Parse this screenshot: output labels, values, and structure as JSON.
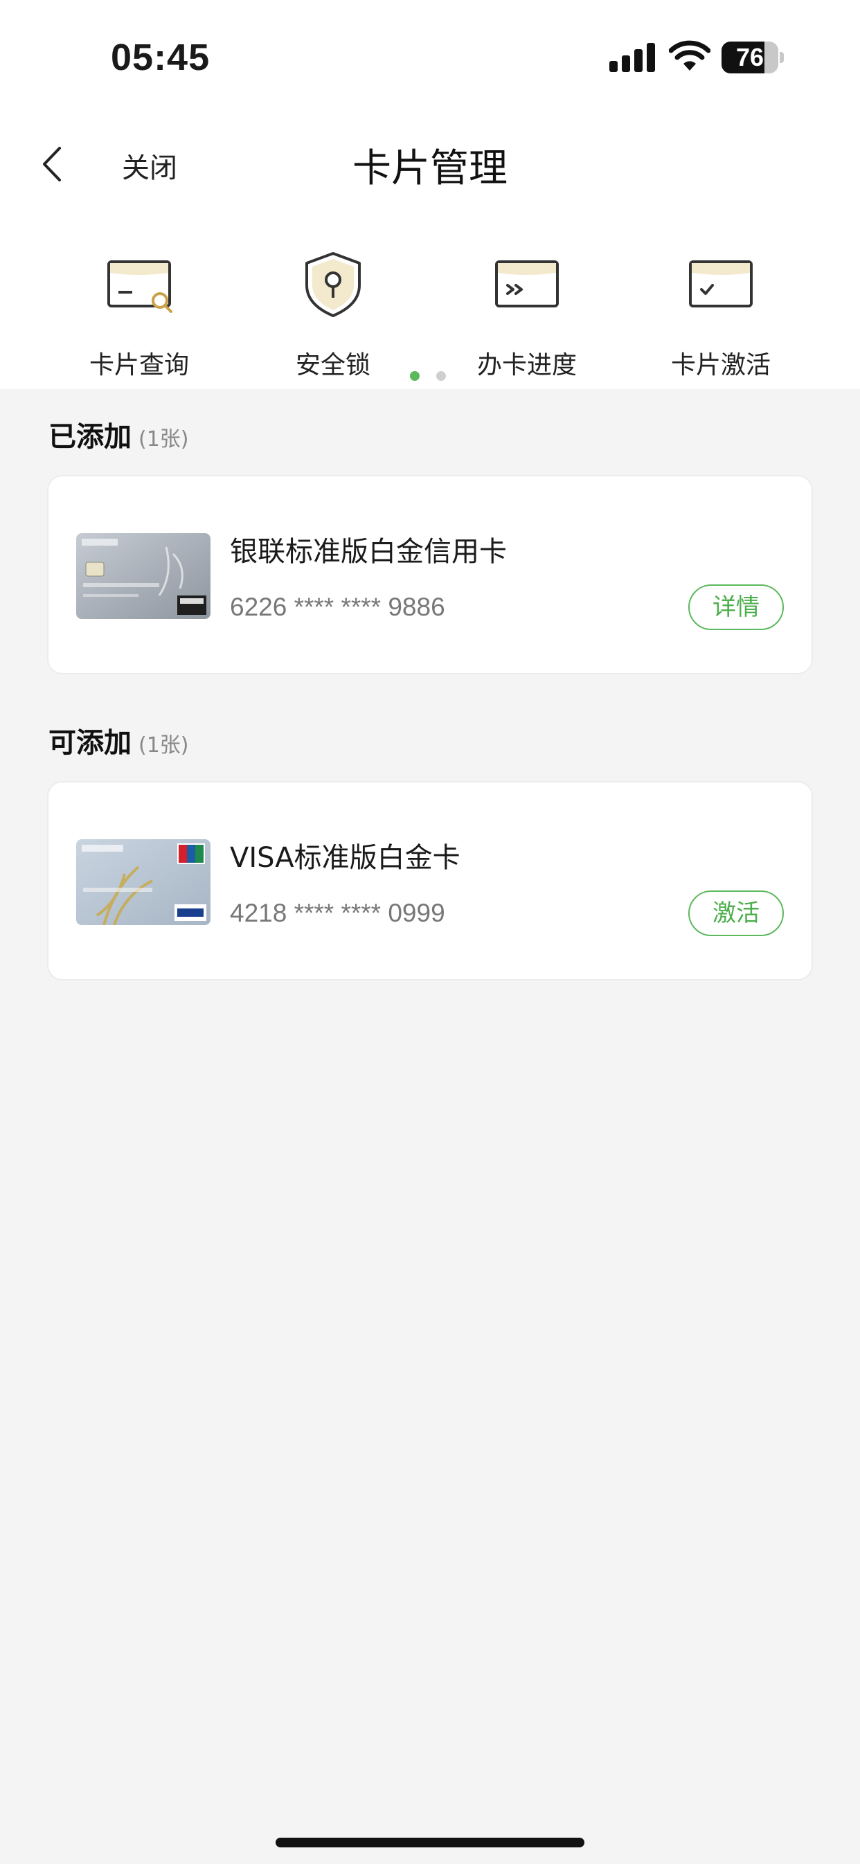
{
  "status_bar": {
    "time": "05:45",
    "battery": "76",
    "battery_level": 0.76
  },
  "nav": {
    "close_label": "关闭",
    "title": "卡片管理"
  },
  "quick_actions": [
    {
      "label": "卡片查询",
      "icon": "card-search-icon"
    },
    {
      "label": "安全锁",
      "icon": "security-lock-icon"
    },
    {
      "label": "办卡进度",
      "icon": "application-progress-icon"
    },
    {
      "label": "卡片激活",
      "icon": "card-activate-icon"
    }
  ],
  "pager": {
    "pages": 2,
    "active": 0
  },
  "added_section": {
    "title": "已添加",
    "count": "(1张)",
    "card": {
      "name": "银联标准版白金信用卡",
      "number": "6226 **** **** 9886",
      "button": "详情"
    }
  },
  "available_section": {
    "title": "可添加",
    "count": "(1张)",
    "card": {
      "name": "VISA标准版白金卡",
      "number": "4218 **** **** 0999",
      "button": "激活"
    }
  },
  "colors": {
    "accent": "#5cb85c",
    "icon_gold": "#f3e9cc",
    "background": "#f4f4f4"
  }
}
